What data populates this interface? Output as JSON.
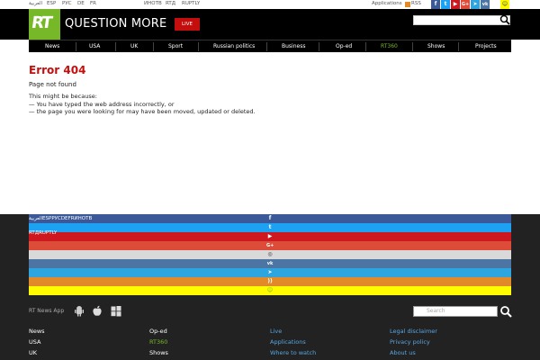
{
  "top_bar": {
    "languages": [
      "العربية",
      "ESP",
      "РУС",
      "DE",
      "FR"
    ],
    "sister_sites": [
      "ИНОТВ",
      "RTД",
      "RUPTLY"
    ],
    "applications_label": "Applications",
    "rss_label": "RSS"
  },
  "header": {
    "logo_text": "RT",
    "brand_text": "QUESTION MORE",
    "live_label": "LIVE",
    "search_placeholder": ""
  },
  "nav": {
    "items": [
      {
        "label": "News"
      },
      {
        "label": "USA"
      },
      {
        "label": "UK"
      },
      {
        "label": "Sport"
      },
      {
        "label": "Russian politics"
      },
      {
        "label": "Business"
      },
      {
        "label": "Op-ed"
      },
      {
        "label": "RT360"
      },
      {
        "label": "Shows"
      },
      {
        "label": "Projects"
      }
    ]
  },
  "error": {
    "title": "Error 404",
    "subtitle": "Page not found",
    "intro": "This might be because:",
    "reasons": [
      "— You have typed the web address incorrectly, or",
      "— the page you were looking for may have been moved, updated or deleted."
    ]
  },
  "footer": {
    "languages_line": "العربيةESPРУСDEFRИНОТВ",
    "sister_line": "RTДRUPTLY",
    "social_bands": [
      {
        "icon": "facebook-icon",
        "glyph": "f",
        "color": "#3b5998"
      },
      {
        "icon": "twitter-icon",
        "glyph": "t",
        "color": "#1da1f2"
      },
      {
        "icon": "youtube-icon",
        "glyph": "▶",
        "color": "#cc181e"
      },
      {
        "icon": "google-plus-icon",
        "glyph": "G+",
        "color": "#dd4b39"
      },
      {
        "icon": "instagram-icon",
        "glyph": "◎",
        "color": "#d9d9d9"
      },
      {
        "icon": "vk-icon",
        "glyph": "vk",
        "color": "#4c75a3"
      },
      {
        "icon": "telegram-icon",
        "glyph": "➤",
        "color": "#2ca5e0"
      },
      {
        "icon": "rss-icon",
        "glyph": "))",
        "color": "#e28a2a"
      },
      {
        "icon": "snapchat-icon",
        "glyph": "👻",
        "color": "#fffc00"
      }
    ],
    "app_label": "RT News App",
    "search_placeholder": "Search",
    "col1": [
      "News",
      "USA",
      "UK"
    ],
    "col2": [
      "Op-ed",
      "RT360",
      "Shows"
    ],
    "col3": [
      "Live",
      "Applications",
      "Where to watch"
    ],
    "col4": [
      "Legal disclaimer",
      "Privacy policy",
      "About us"
    ]
  },
  "colors": {
    "brand_green": "#77b829",
    "live_red": "#c40e0e",
    "error_red": "#c40e0e",
    "footer_link_blue": "#59a6e0"
  }
}
